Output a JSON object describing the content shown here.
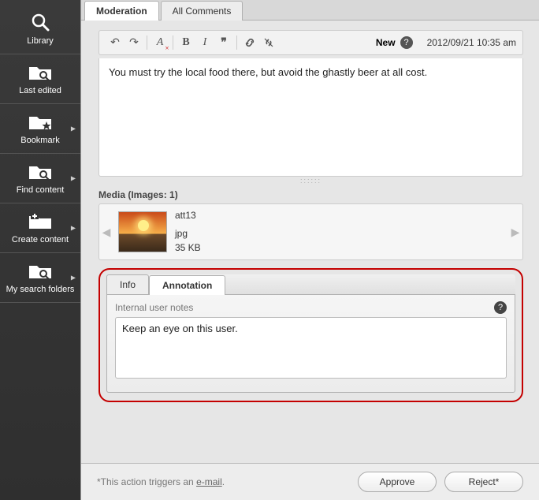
{
  "sidebar": {
    "items": [
      {
        "label": "Library",
        "icon": "magnifier",
        "arrow": false
      },
      {
        "label": "Last edited",
        "icon": "folder-mag",
        "arrow": false
      },
      {
        "label": "Bookmark",
        "icon": "folder-star",
        "arrow": true
      },
      {
        "label": "Find content",
        "icon": "folder-mag",
        "arrow": true
      },
      {
        "label": "Create content",
        "icon": "folder-plus",
        "arrow": true
      },
      {
        "label": "My search folders",
        "icon": "folder-mag",
        "arrow": true
      }
    ]
  },
  "tabs": {
    "moderation": "Moderation",
    "all_comments": "All Comments"
  },
  "toolbar": {
    "status": "New",
    "timestamp": "2012/09/21 10:35 am"
  },
  "editor": {
    "body": "You must try the local food there, but avoid the ghastly beer at all cost."
  },
  "media": {
    "label": "Media (Images: 1)",
    "item": {
      "name": "att13",
      "ext": "jpg",
      "size": "35 KB"
    }
  },
  "annotation": {
    "tabs": {
      "info": "Info",
      "annotation": "Annotation"
    },
    "notes_label": "Internal user notes",
    "notes_value": "Keep an eye on this user."
  },
  "footer": {
    "note_prefix": "*This action triggers an ",
    "note_link": "e-mail",
    "note_suffix": ".",
    "approve": "Approve",
    "reject": "Reject*"
  }
}
